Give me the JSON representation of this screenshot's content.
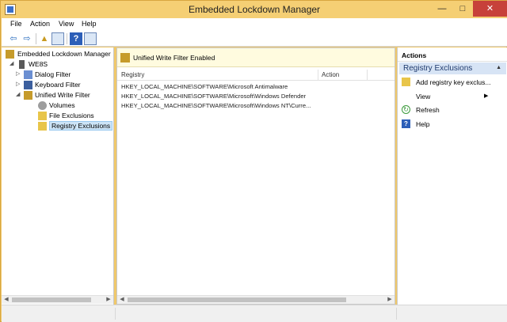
{
  "window": {
    "title": "Embedded Lockdown Manager"
  },
  "menu": [
    "File",
    "Action",
    "View",
    "Help"
  ],
  "toolbar": {
    "back_icon": "back-arrow-icon",
    "forward_icon": "forward-arrow-icon",
    "up_icon": "up-folder-icon",
    "console_tree_icon": "show-hide-tree-icon",
    "help_icon": "help-icon",
    "action_pane_icon": "show-hide-action-pane-icon"
  },
  "tree": {
    "root": "Embedded Lockdown Manager",
    "device": "WE8S",
    "dialog_filter": "Dialog Filter",
    "keyboard_filter": "Keyboard Filter",
    "uwf": "Unified Write Filter",
    "volumes": "Volumes",
    "file_exclusions": "File Exclusions",
    "registry_exclusions": "Registry Exclusions"
  },
  "banner": {
    "text": "Unified Write Filter Enabled"
  },
  "list": {
    "columns": [
      "Registry",
      "Action"
    ],
    "rows": [
      "HKEY_LOCAL_MACHINE\\SOFTWARE\\Microsoft Antimalware",
      "HKEY_LOCAL_MACHINE\\SOFTWARE\\Microsoft\\Windows Defender",
      "HKEY_LOCAL_MACHINE\\SOFTWARE\\Microsoft\\Windows NT\\Curre..."
    ]
  },
  "actions": {
    "header": "Actions",
    "section": "Registry Exclusions",
    "items": {
      "add": "Add registry key exclus...",
      "view": "View",
      "refresh": "Refresh",
      "help": "Help"
    }
  },
  "colors": {
    "title_bg": "#f5cf74",
    "close": "#c7413a",
    "section": "#d7e4f5",
    "selection": "#cce4f7"
  }
}
